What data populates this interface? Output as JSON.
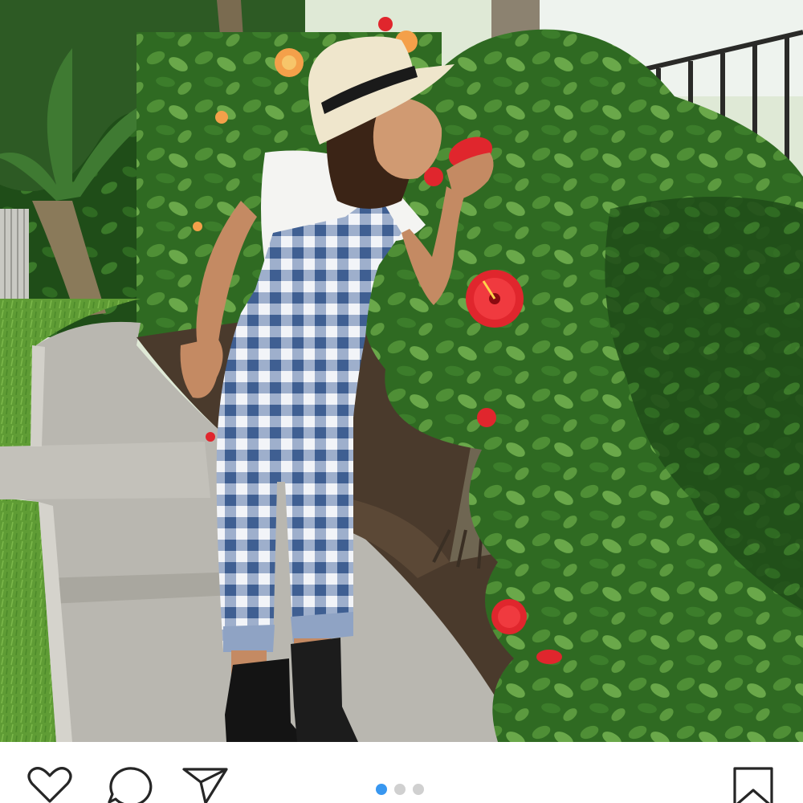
{
  "post": {
    "image": {
      "subject": "photo",
      "colors": {
        "sky": "#e8efe6",
        "foliage": "#3e7a2c",
        "flower": "#e0262d",
        "path": "#b7b5ad",
        "lawn": "#6aa33a",
        "gingham_dark": "#3f5f92",
        "gingham_light": "#f2f4f8"
      }
    },
    "actions": {
      "like_icon": "heart-icon",
      "comment_icon": "speech-bubble-icon",
      "share_icon": "paper-plane-icon",
      "save_icon": "bookmark-icon"
    },
    "carousel": {
      "total": 3,
      "active_index": 0,
      "active_color": "#3897f0",
      "inactive_color": "#d0d0d0"
    }
  }
}
